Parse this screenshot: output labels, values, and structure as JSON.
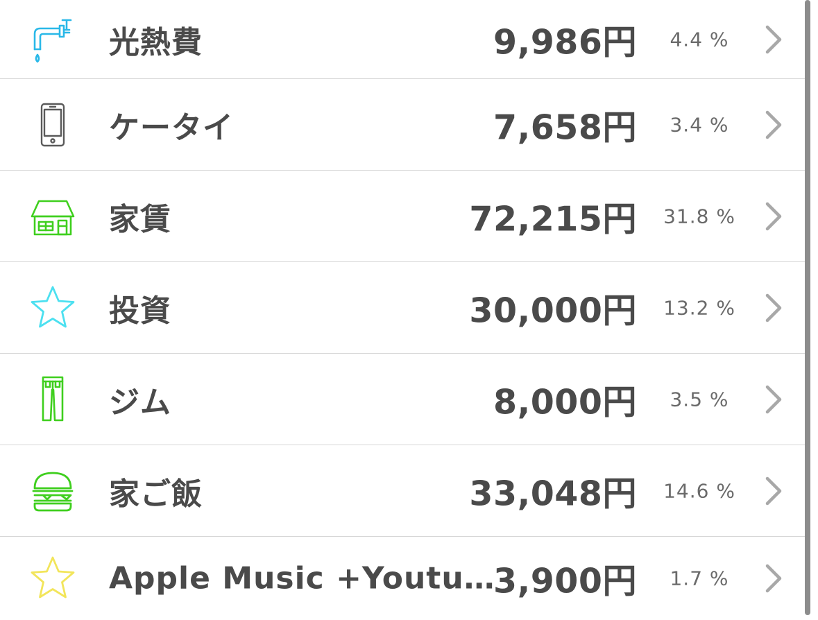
{
  "currency_suffix": "円",
  "rows": [
    {
      "label": "光熱費",
      "amount": "9,986円",
      "percent": "4.4 %",
      "icon": "faucet-icon",
      "icon_color": "#29b8e8"
    },
    {
      "label": "ケータイ",
      "amount": "7,658円",
      "percent": "3.4 %",
      "icon": "smartphone-icon",
      "icon_color": "#5a5a5a"
    },
    {
      "label": "家賃",
      "amount": "72,215円",
      "percent": "31.8 %",
      "icon": "house-icon",
      "icon_color": "#3fcf1e"
    },
    {
      "label": "投資",
      "amount": "30,000円",
      "percent": "13.2 %",
      "icon": "star-icon",
      "icon_color": "#4ce0f0"
    },
    {
      "label": "ジム",
      "amount": "8,000円",
      "percent": "3.5 %",
      "icon": "pants-icon",
      "icon_color": "#3fcf1e"
    },
    {
      "label": "家ご飯",
      "amount": "33,048円",
      "percent": "14.6 %",
      "icon": "burger-icon",
      "icon_color": "#3fcf1e"
    },
    {
      "label": "Apple Music +Youtu…",
      "amount": "3,900円",
      "percent": "1.7 %",
      "icon": "star-icon",
      "icon_color": "#f2e55a"
    }
  ],
  "colors": {
    "text_primary": "#4a4a4a",
    "text_secondary": "#6a6a6a",
    "separator": "#d6d6d6",
    "chevron": "#a8a8a8"
  }
}
